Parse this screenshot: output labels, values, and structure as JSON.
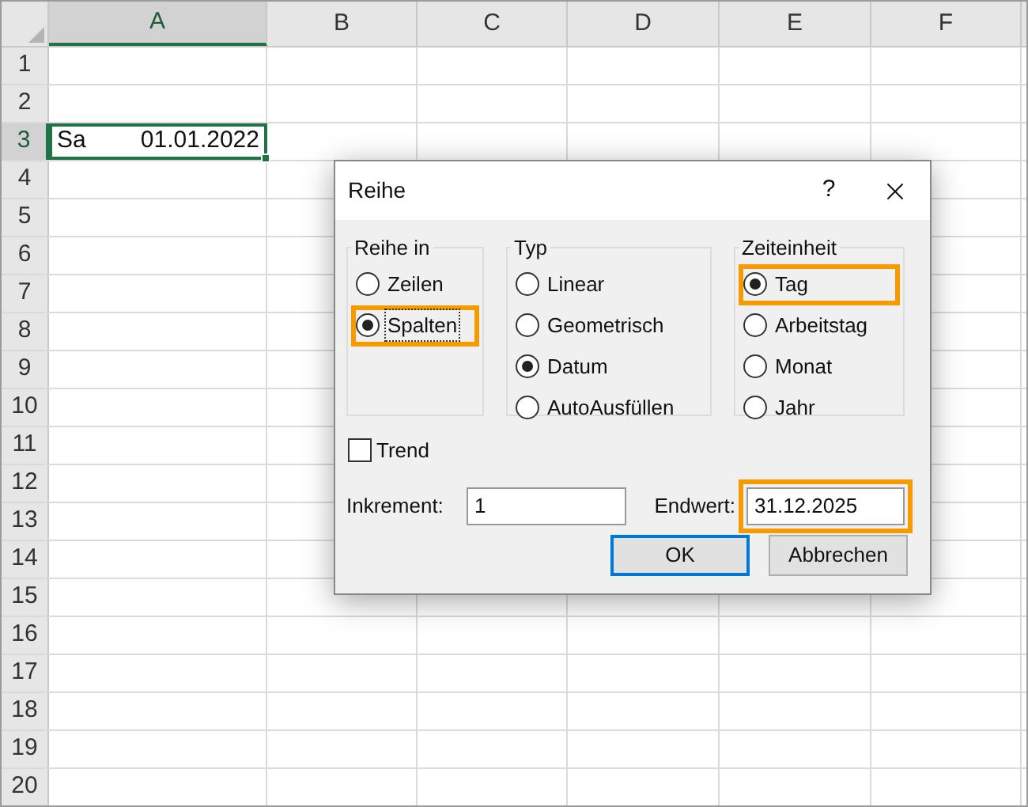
{
  "columns": [
    {
      "label": "A",
      "selected": true
    },
    {
      "label": "B",
      "selected": false
    },
    {
      "label": "C",
      "selected": false
    },
    {
      "label": "D",
      "selected": false
    },
    {
      "label": "E",
      "selected": false
    },
    {
      "label": "F",
      "selected": false
    }
  ],
  "rows": [
    {
      "label": "1",
      "selected": false
    },
    {
      "label": "2",
      "selected": false
    },
    {
      "label": "3",
      "selected": true,
      "cells": [
        {
          "prefix": "Sa",
          "value": "01.01.2022",
          "selected": true
        }
      ]
    },
    {
      "label": "4",
      "selected": false
    },
    {
      "label": "5",
      "selected": false
    },
    {
      "label": "6",
      "selected": false
    },
    {
      "label": "7",
      "selected": false
    },
    {
      "label": "8",
      "selected": false
    },
    {
      "label": "9",
      "selected": false
    },
    {
      "label": "10",
      "selected": false
    },
    {
      "label": "11",
      "selected": false
    },
    {
      "label": "12",
      "selected": false
    },
    {
      "label": "13",
      "selected": false
    },
    {
      "label": "14",
      "selected": false
    },
    {
      "label": "15",
      "selected": false
    },
    {
      "label": "16",
      "selected": false
    },
    {
      "label": "17",
      "selected": false
    },
    {
      "label": "18",
      "selected": false
    },
    {
      "label": "19",
      "selected": false
    },
    {
      "label": "20",
      "selected": false
    }
  ],
  "dialog": {
    "title": "Reihe",
    "help": "?",
    "groups": [
      {
        "title": "Reihe in",
        "options": [
          {
            "label": "Zeilen",
            "selected": false,
            "highlighted": false,
            "focused": false
          },
          {
            "label": "Spalten",
            "selected": true,
            "highlighted": true,
            "focused": true
          }
        ]
      },
      {
        "title": "Typ",
        "options": [
          {
            "label": "Linear",
            "selected": false,
            "highlighted": false,
            "focused": false
          },
          {
            "label": "Geometrisch",
            "selected": false,
            "highlighted": false,
            "focused": false
          },
          {
            "label": "Datum",
            "selected": true,
            "highlighted": false,
            "focused": false
          },
          {
            "label": "AutoAusfüllen",
            "selected": false,
            "highlighted": false,
            "focused": false
          }
        ]
      },
      {
        "title": "Zeiteinheit",
        "options": [
          {
            "label": "Tag",
            "selected": true,
            "highlighted": true,
            "focused": false
          },
          {
            "label": "Arbeitstag",
            "selected": false,
            "highlighted": false,
            "focused": false
          },
          {
            "label": "Monat",
            "selected": false,
            "highlighted": false,
            "focused": false
          },
          {
            "label": "Jahr",
            "selected": false,
            "highlighted": false,
            "focused": false
          }
        ]
      }
    ],
    "trend": {
      "label": "Trend",
      "checked": false
    },
    "increment": {
      "label": "Inkrement:",
      "value": "1"
    },
    "end_value": {
      "label": "Endwert:",
      "value": "31.12.2025",
      "highlighted": true
    },
    "buttons": [
      {
        "label": "OK",
        "default": true
      },
      {
        "label": "Abbrechen",
        "default": false
      }
    ]
  }
}
